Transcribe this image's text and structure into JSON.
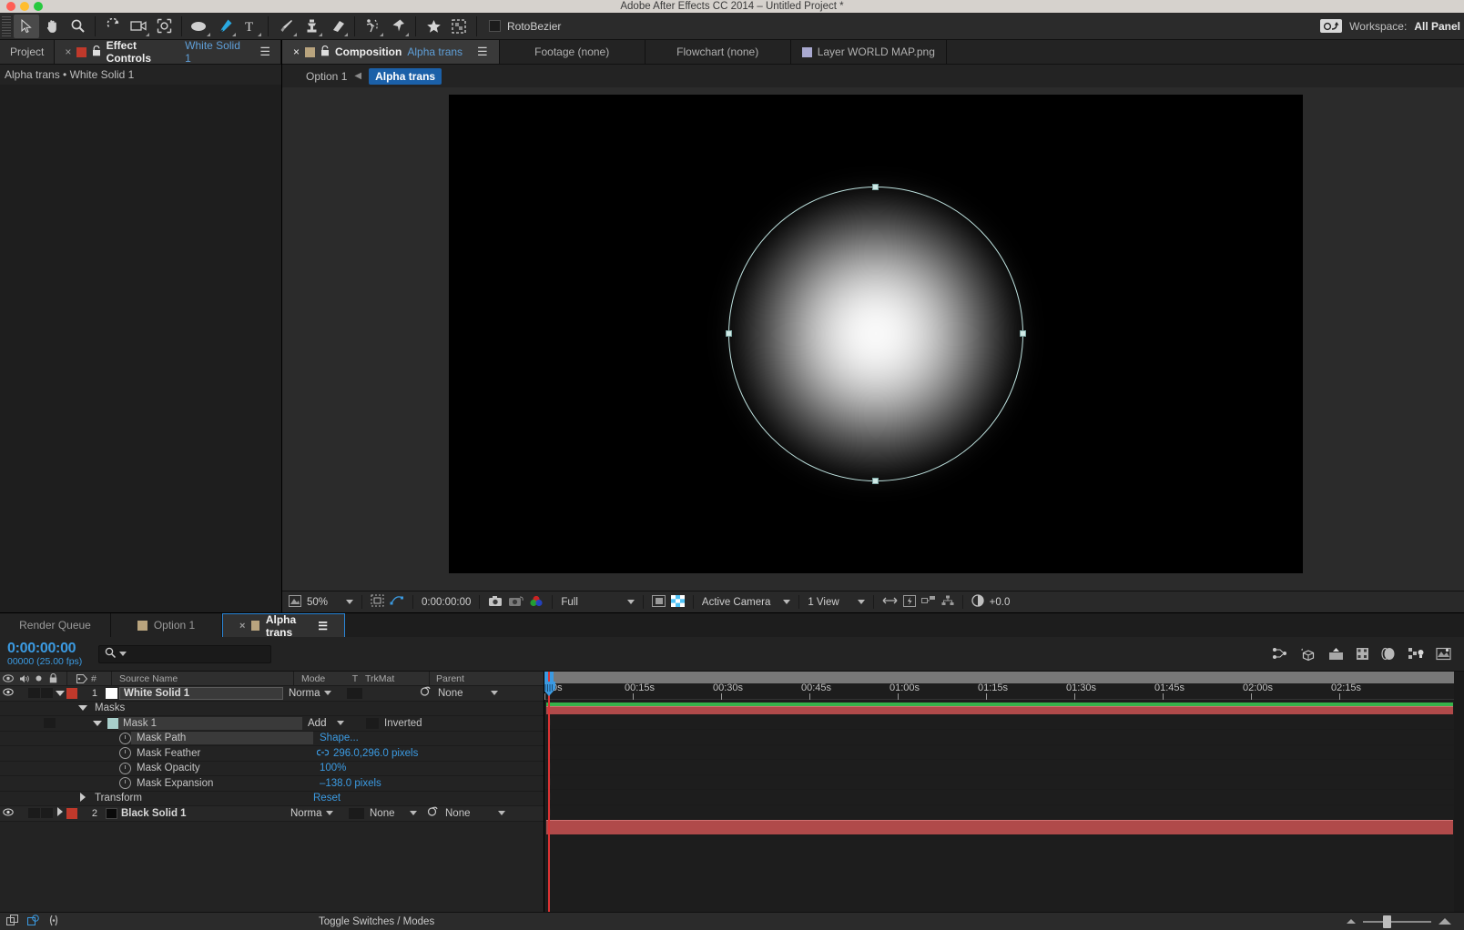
{
  "window": {
    "title": "Adobe After Effects CC 2014 – Untitled Project *"
  },
  "toolbar": {
    "tools": [
      {
        "name": "selection-tool",
        "glyph": "arrow"
      },
      {
        "name": "hand-tool",
        "glyph": "hand"
      },
      {
        "name": "zoom-tool",
        "glyph": "magnifier"
      },
      {
        "name": "rotation-tool",
        "glyph": "rotate"
      },
      {
        "name": "camera-tool",
        "glyph": "camera"
      },
      {
        "name": "pan-behind-tool",
        "glyph": "anchor"
      },
      {
        "name": "shape-tool",
        "glyph": "ellipse"
      },
      {
        "name": "pen-tool",
        "glyph": "pen"
      },
      {
        "name": "type-tool",
        "glyph": "T"
      },
      {
        "name": "brush-tool",
        "glyph": "brush"
      },
      {
        "name": "clone-stamp-tool",
        "glyph": "stamp"
      },
      {
        "name": "eraser-tool",
        "glyph": "eraser"
      },
      {
        "name": "roto-brush-tool",
        "glyph": "roto"
      },
      {
        "name": "puppet-pin-tool",
        "glyph": "pin"
      }
    ],
    "star_label": "favorite",
    "grid_label": "transparency-grid",
    "rotobezier_label": "RotoBezier",
    "rotobezier_checked": false,
    "workspace_label": "Workspace:",
    "workspace_value": "All Panel"
  },
  "left_panel": {
    "project_tab": "Project",
    "effect_controls_title": "Effect Controls",
    "effect_controls_subject": "White Solid 1",
    "breadcrumb": "Alpha trans • White Solid 1"
  },
  "viewer": {
    "tabs": [
      {
        "label": "Composition",
        "value": "Alpha trans",
        "active": true
      },
      {
        "label": "Footage (none)",
        "value": "",
        "active": false
      },
      {
        "label": "Flowchart (none)",
        "value": "",
        "active": false
      },
      {
        "label": "Layer WORLD MAP.png",
        "value": "",
        "active": false
      }
    ],
    "breadcrumb_parent": "Option 1",
    "breadcrumb_current": "Alpha trans",
    "bottom_bar": {
      "magnification": "50%",
      "timecode": "0:00:00:00",
      "resolution": "Full",
      "camera": "Active Camera",
      "views": "1 View",
      "exposure": "+0.0"
    }
  },
  "timeline": {
    "tabs": [
      {
        "label": "Render Queue",
        "active": false,
        "has_swatch": false
      },
      {
        "label": "Option 1",
        "active": false,
        "has_swatch": true
      },
      {
        "label": "Alpha trans",
        "active": true,
        "has_swatch": true
      }
    ],
    "current_time": "0:00:00:00",
    "frame_info": "00000 (25.00 fps)",
    "search_placeholder": "",
    "columns": [
      "#",
      "Source Name",
      "Mode",
      "T",
      "TrkMat",
      "Parent"
    ],
    "ruler_labels": [
      "0s",
      "00:15s",
      "00:30s",
      "00:45s",
      "01:00s",
      "01:15s",
      "01:30s",
      "01:45s",
      "02:00s",
      "02:15s"
    ],
    "rows": [
      {
        "type": "layer",
        "index": "1",
        "name": "White Solid 1",
        "mode": "Norma",
        "trkmat": "",
        "parent": "None",
        "swatch": "#c0392b",
        "selected": true
      },
      {
        "type": "group",
        "name": "Masks",
        "indent": 1
      },
      {
        "type": "mask",
        "name": "Mask 1",
        "mode": "Add",
        "inverted_label": "Inverted",
        "indent": 2
      },
      {
        "type": "prop",
        "name": "Mask Path",
        "value": "Shape...",
        "indent": 3,
        "highlight": true
      },
      {
        "type": "prop",
        "name": "Mask Feather",
        "value": "296.0,296.0 pixels",
        "indent": 3,
        "linked": true
      },
      {
        "type": "prop",
        "name": "Mask Opacity",
        "value": "100%",
        "indent": 3
      },
      {
        "type": "prop",
        "name": "Mask Expansion",
        "value": "–138.0 pixels",
        "indent": 3
      },
      {
        "type": "group",
        "name": "Transform",
        "value": "Reset",
        "indent": 1,
        "collapsed": true
      },
      {
        "type": "layer",
        "index": "2",
        "name": "Black Solid 1",
        "mode": "Norma",
        "trkmat": "None",
        "parent": "None",
        "swatch": "#c0392b",
        "selected": false
      }
    ],
    "footer": {
      "toggle_label": "Toggle Switches / Modes"
    }
  }
}
